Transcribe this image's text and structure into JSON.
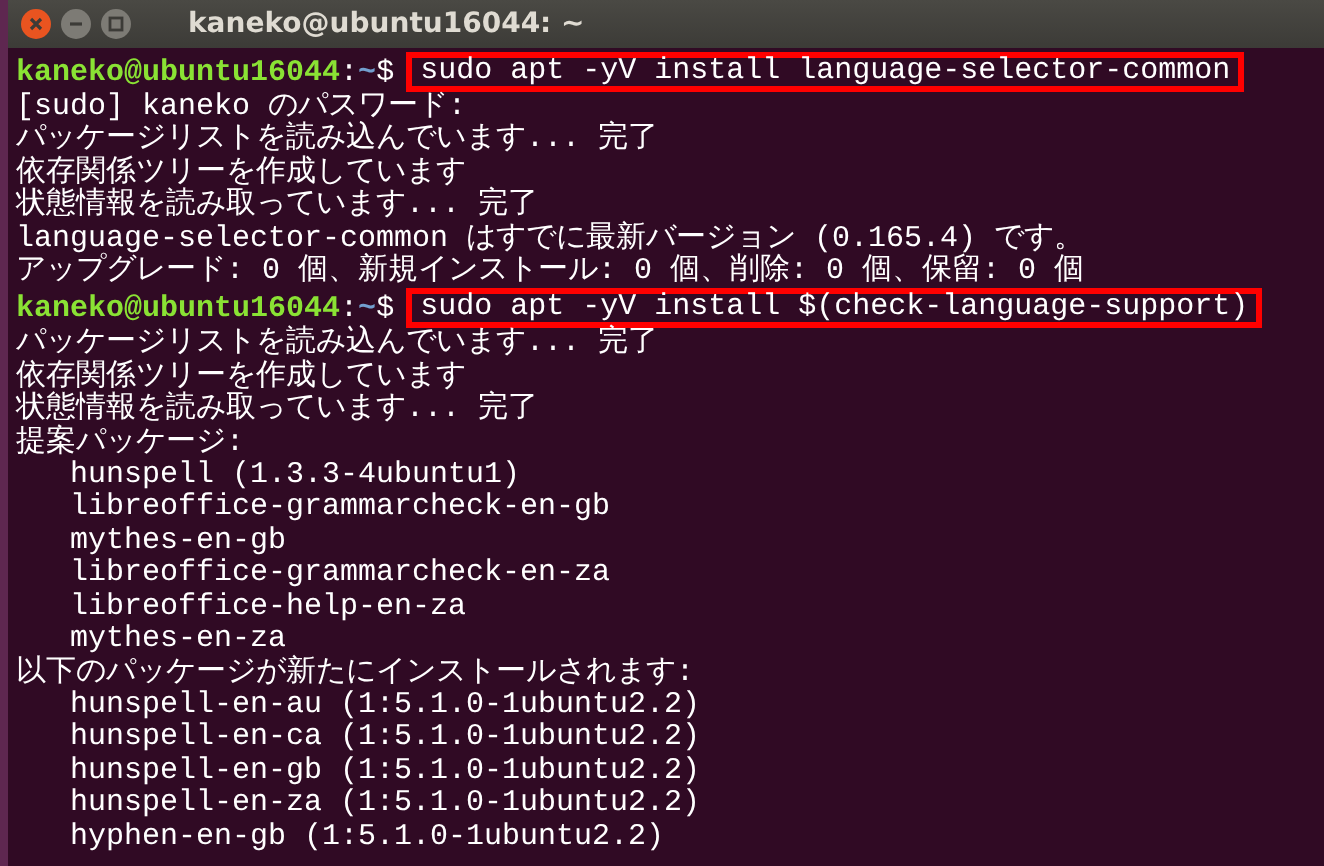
{
  "window": {
    "title": "kaneko@ubuntu16044: ~"
  },
  "lines": [
    {
      "kind": "prompt",
      "user_host": "kaneko@ubuntu16044",
      "separator": ":",
      "path": "~",
      "symbol": "$",
      "command": "sudo apt -yV install language-selector-common",
      "highlighted": true
    },
    {
      "kind": "output",
      "text": "[sudo] kaneko のパスワード:"
    },
    {
      "kind": "output",
      "text": "パッケージリストを読み込んでいます... 完了"
    },
    {
      "kind": "output",
      "text": "依存関係ツリーを作成しています"
    },
    {
      "kind": "output",
      "text": "状態情報を読み取っています... 完了"
    },
    {
      "kind": "output",
      "text": "language-selector-common はすでに最新バージョン (0.165.4) です。"
    },
    {
      "kind": "output",
      "text": "アップグレード: 0 個、新規インストール: 0 個、削除: 0 個、保留: 0 個"
    },
    {
      "kind": "prompt",
      "user_host": "kaneko@ubuntu16044",
      "separator": ":",
      "path": "~",
      "symbol": "$",
      "command": "sudo apt -yV install $(check-language-support)",
      "highlighted": true
    },
    {
      "kind": "output",
      "text": "パッケージリストを読み込んでいます... 完了"
    },
    {
      "kind": "output",
      "text": "依存関係ツリーを作成しています"
    },
    {
      "kind": "output",
      "text": "状態情報を読み取っています... 完了"
    },
    {
      "kind": "output",
      "text": "提案パッケージ:"
    },
    {
      "kind": "package",
      "text": "hunspell (1.3.3-4ubuntu1)"
    },
    {
      "kind": "package",
      "text": "libreoffice-grammarcheck-en-gb"
    },
    {
      "kind": "package",
      "text": "mythes-en-gb"
    },
    {
      "kind": "package",
      "text": "libreoffice-grammarcheck-en-za"
    },
    {
      "kind": "package",
      "text": "libreoffice-help-en-za"
    },
    {
      "kind": "package",
      "text": "mythes-en-za"
    },
    {
      "kind": "output",
      "text": "以下のパッケージが新たにインストールされます:"
    },
    {
      "kind": "package",
      "text": "hunspell-en-au (1:5.1.0-1ubuntu2.2)"
    },
    {
      "kind": "package",
      "text": "hunspell-en-ca (1:5.1.0-1ubuntu2.2)"
    },
    {
      "kind": "package",
      "text": "hunspell-en-gb (1:5.1.0-1ubuntu2.2)"
    },
    {
      "kind": "package",
      "text": "hunspell-en-za (1:5.1.0-1ubuntu2.2)"
    },
    {
      "kind": "package",
      "text": "hyphen-en-gb (1:5.1.0-1ubuntu2.2)"
    }
  ]
}
